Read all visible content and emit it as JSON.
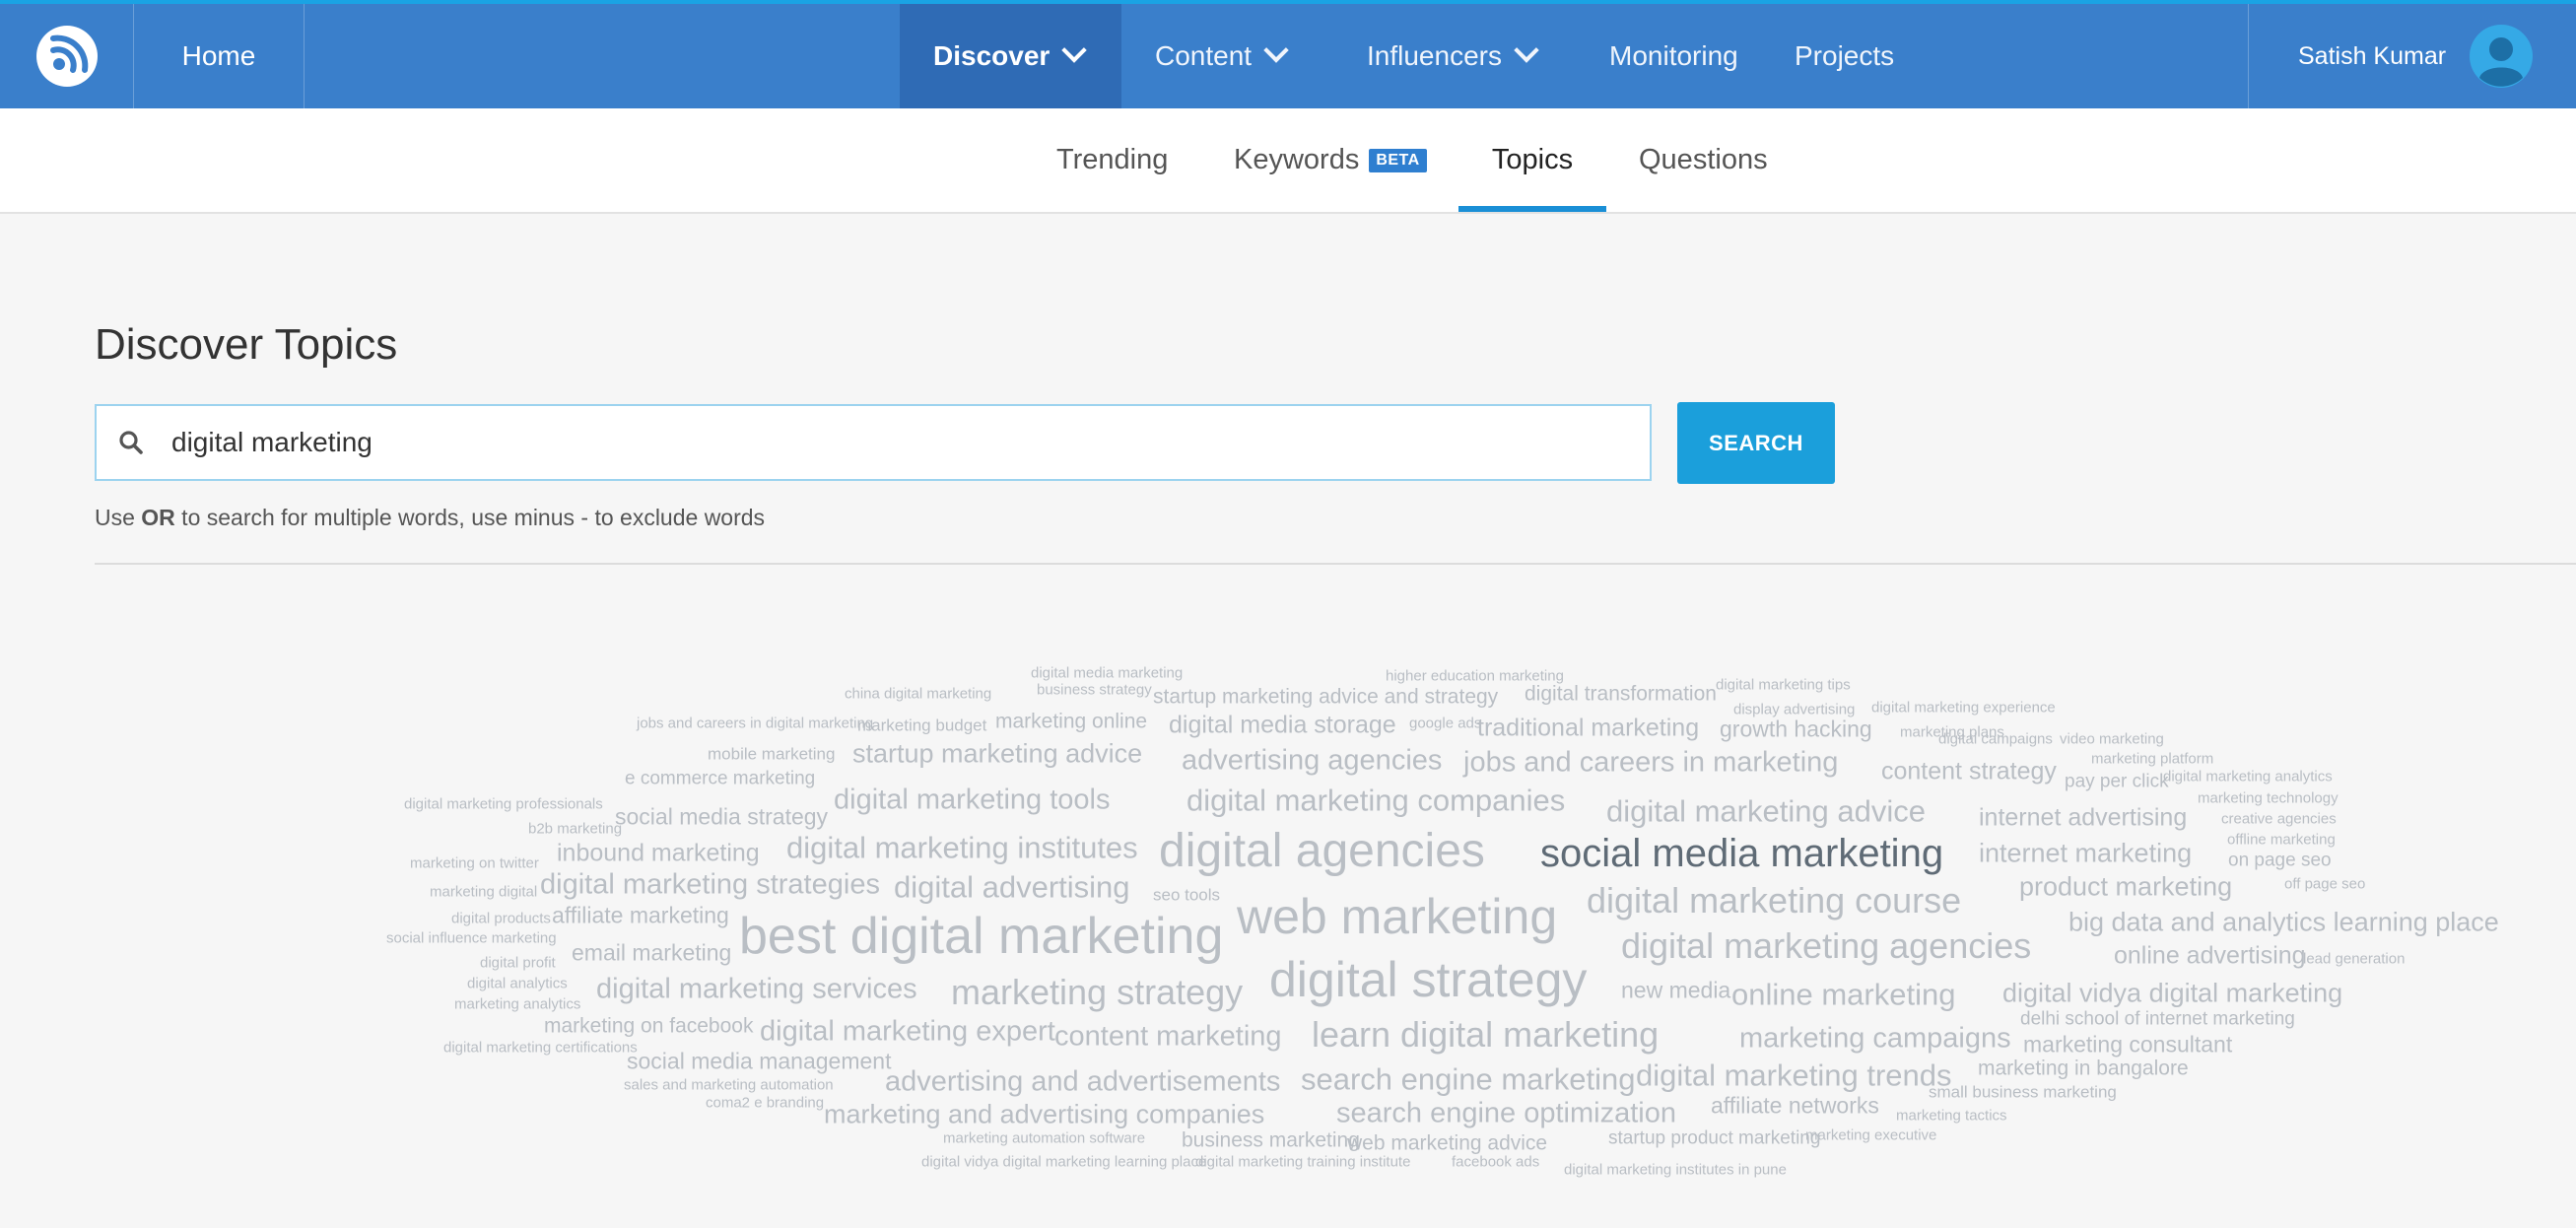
{
  "header": {
    "logo_icon": "rss-feed-icon",
    "home": "Home",
    "nav": [
      {
        "label": "Discover",
        "dropdown": true,
        "active": true
      },
      {
        "label": "Content",
        "dropdown": true
      },
      {
        "label": "Influencers",
        "dropdown": true
      },
      {
        "label": "Monitoring"
      },
      {
        "label": "Projects"
      }
    ],
    "user_name": "Satish Kumar",
    "avatar_icon": "user-avatar-icon"
  },
  "subnav": {
    "tabs": [
      "Trending",
      "Keywords",
      "Topics",
      "Questions"
    ],
    "keywords_badge": "BETA",
    "active_tab": "Topics"
  },
  "main": {
    "title": "Discover Topics",
    "search_value": "digital marketing",
    "search_icon": "search-icon",
    "search_button": "SEARCH",
    "hint_prefix": "Use ",
    "hint_bold": "OR",
    "hint_suffix": " to search for multiple words, use minus - to exclude words"
  },
  "word_cloud": [
    {
      "text": "digital media marketing",
      "weight": 0.05
    },
    {
      "text": "business strategy",
      "weight": 0.05
    },
    {
      "text": "higher education marketing",
      "weight": 0.05
    },
    {
      "text": "china digital marketing",
      "weight": 0.05
    },
    {
      "text": "startup marketing advice and strategy",
      "weight": 0.2
    },
    {
      "text": "digital transformation",
      "weight": 0.2
    },
    {
      "text": "digital marketing tips",
      "weight": 0.05
    },
    {
      "text": "digital marketing experience",
      "weight": 0.05
    },
    {
      "text": "display advertising",
      "weight": 0.05
    },
    {
      "text": "jobs and careers in digital marketing",
      "weight": 0.05
    },
    {
      "text": "marketing budget",
      "weight": 0.1
    },
    {
      "text": "marketing online",
      "weight": 0.2
    },
    {
      "text": "digital media storage",
      "weight": 0.3
    },
    {
      "text": "google ads",
      "weight": 0.05
    },
    {
      "text": "traditional marketing",
      "weight": 0.3
    },
    {
      "text": "growth hacking",
      "weight": 0.25
    },
    {
      "text": "marketing plans",
      "weight": 0.05
    },
    {
      "text": "digital campaigns",
      "weight": 0.05
    },
    {
      "text": "video marketing",
      "weight": 0.05
    },
    {
      "text": "marketing platform",
      "weight": 0.05
    },
    {
      "text": "mobile marketing",
      "weight": 0.1
    },
    {
      "text": "startup marketing advice",
      "weight": 0.35
    },
    {
      "text": "advertising agencies",
      "weight": 0.4
    },
    {
      "text": "jobs and careers in marketing",
      "weight": 0.4
    },
    {
      "text": "content strategy",
      "weight": 0.3
    },
    {
      "text": "e commerce marketing",
      "weight": 0.15
    },
    {
      "text": "pay per click",
      "weight": 0.15
    },
    {
      "text": "digital marketing analytics",
      "weight": 0.05
    },
    {
      "text": "digital marketing professionals",
      "weight": 0.05
    },
    {
      "text": "digital marketing tools",
      "weight": 0.4
    },
    {
      "text": "digital marketing companies",
      "weight": 0.45
    },
    {
      "text": "marketing technology",
      "weight": 0.05
    },
    {
      "text": "social media strategy",
      "weight": 0.25
    },
    {
      "text": "digital marketing advice",
      "weight": 0.45
    },
    {
      "text": "internet advertising",
      "weight": 0.3
    },
    {
      "text": "creative agencies",
      "weight": 0.05
    },
    {
      "text": "b2b marketing",
      "weight": 0.05
    },
    {
      "text": "offline marketing",
      "weight": 0.05
    },
    {
      "text": "digital agencies",
      "weight": 0.9
    },
    {
      "text": "social media marketing",
      "weight": 0.7,
      "highlight": true
    },
    {
      "text": "inbound marketing",
      "weight": 0.3
    },
    {
      "text": "digital marketing institutes",
      "weight": 0.45
    },
    {
      "text": "internet marketing",
      "weight": 0.35
    },
    {
      "text": "marketing on twitter",
      "weight": 0.05
    },
    {
      "text": "on page seo",
      "weight": 0.15
    },
    {
      "text": "digital marketing strategies",
      "weight": 0.4
    },
    {
      "text": "digital advertising",
      "weight": 0.45
    },
    {
      "text": "marketing digital",
      "weight": 0.05
    },
    {
      "text": "seo tools",
      "weight": 0.1
    },
    {
      "text": "web marketing",
      "weight": 0.95
    },
    {
      "text": "digital marketing course",
      "weight": 0.6
    },
    {
      "text": "product marketing",
      "weight": 0.35
    },
    {
      "text": "off page seo",
      "weight": 0.05
    },
    {
      "text": "digital products",
      "weight": 0.05
    },
    {
      "text": "affiliate marketing",
      "weight": 0.25
    },
    {
      "text": "social influence marketing",
      "weight": 0.05
    },
    {
      "text": "best digital marketing",
      "weight": 1.0
    },
    {
      "text": "big data and analytics learning place",
      "weight": 0.35
    },
    {
      "text": "digital marketing agencies",
      "weight": 0.6
    },
    {
      "text": "email marketing",
      "weight": 0.25
    },
    {
      "text": "online advertising",
      "weight": 0.3
    },
    {
      "text": "digital profit",
      "weight": 0.05
    },
    {
      "text": "lead generation",
      "weight": 0.05
    },
    {
      "text": "digital analytics",
      "weight": 0.05
    },
    {
      "text": "digital strategy",
      "weight": 0.95
    },
    {
      "text": "digital marketing services",
      "weight": 0.4
    },
    {
      "text": "marketing strategy",
      "weight": 0.6
    },
    {
      "text": "new media",
      "weight": 0.25
    },
    {
      "text": "online marketing",
      "weight": 0.45
    },
    {
      "text": "digital vidya digital marketing",
      "weight": 0.35
    },
    {
      "text": "marketing analytics",
      "weight": 0.05
    },
    {
      "text": "delhi school of internet marketing",
      "weight": 0.15
    },
    {
      "text": "marketing on facebook",
      "weight": 0.2
    },
    {
      "text": "digital marketing expert",
      "weight": 0.4
    },
    {
      "text": "content marketing",
      "weight": 0.4
    },
    {
      "text": "learn digital marketing",
      "weight": 0.6
    },
    {
      "text": "marketing campaigns",
      "weight": 0.4
    },
    {
      "text": "marketing consultant",
      "weight": 0.25
    },
    {
      "text": "digital marketing certifications",
      "weight": 0.05
    },
    {
      "text": "social media management",
      "weight": 0.25
    },
    {
      "text": "marketing in bangalore",
      "weight": 0.2
    },
    {
      "text": "advertising and advertisements",
      "weight": 0.4
    },
    {
      "text": "search engine marketing",
      "weight": 0.45
    },
    {
      "text": "digital marketing trends",
      "weight": 0.45
    },
    {
      "text": "sales and marketing automation",
      "weight": 0.05
    },
    {
      "text": "small business marketing",
      "weight": 0.1
    },
    {
      "text": "coma2 e branding",
      "weight": 0.05
    },
    {
      "text": "affiliate networks",
      "weight": 0.25
    },
    {
      "text": "marketing and advertising companies",
      "weight": 0.35
    },
    {
      "text": "search engine optimization",
      "weight": 0.4
    },
    {
      "text": "marketing tactics",
      "weight": 0.05
    },
    {
      "text": "marketing automation software",
      "weight": 0.05
    },
    {
      "text": "business marketing",
      "weight": 0.2
    },
    {
      "text": "web marketing advice",
      "weight": 0.2
    },
    {
      "text": "startup product marketing",
      "weight": 0.15
    },
    {
      "text": "marketing executive",
      "weight": 0.05
    },
    {
      "text": "digital vidya digital marketing learning place",
      "weight": 0.05
    },
    {
      "text": "digital marketing training institute",
      "weight": 0.05
    },
    {
      "text": "facebook ads",
      "weight": 0.05
    },
    {
      "text": "digital marketing institutes in pune",
      "weight": 0.05
    }
  ],
  "colors": {
    "topbar": "#3a7fcb",
    "accent": "#1b9fdb",
    "cloud_text": "#b9bec4",
    "cloud_highlight": "#5f6b76"
  }
}
